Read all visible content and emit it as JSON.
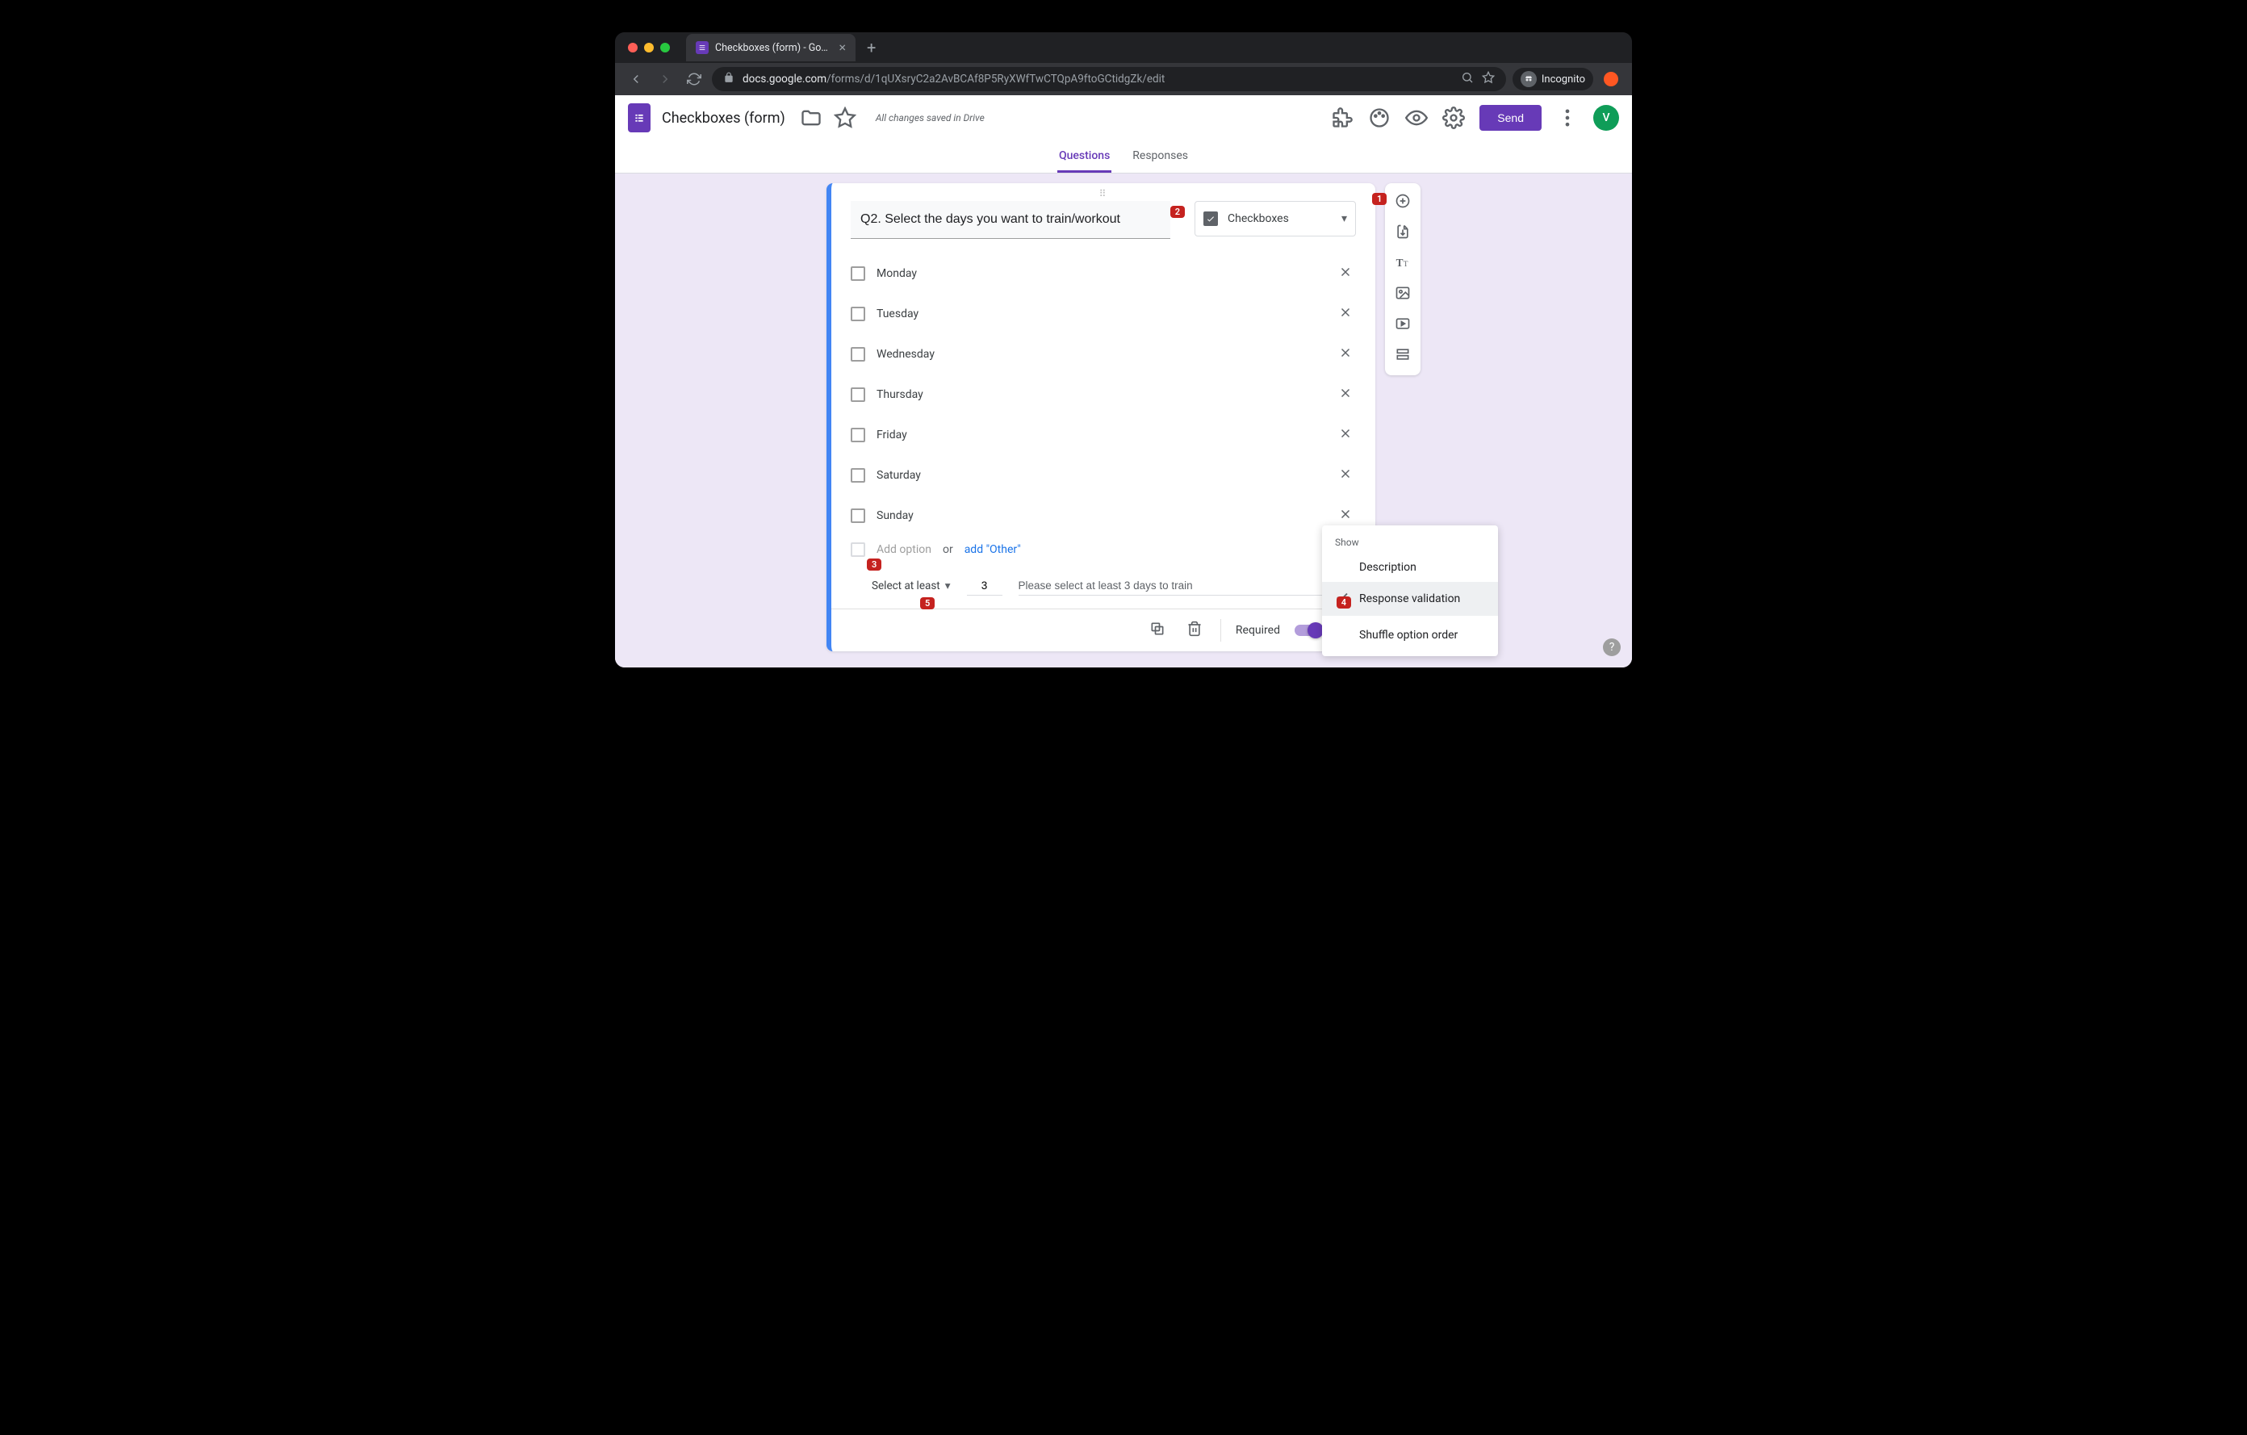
{
  "browser": {
    "tab_title": "Checkboxes (form) - Google Fo",
    "url_host": "docs.google.com",
    "url_path": "/forms/d/1qUXsryC2a2AvBCAf8P5RyXWfTwCTQpA9ftoGCtidgZk/edit",
    "incognito_label": "Incognito"
  },
  "header": {
    "doc_title": "Checkboxes (form)",
    "saved_status": "All changes saved in Drive",
    "send_label": "Send",
    "avatar_initial": "V"
  },
  "tabs": {
    "questions": "Questions",
    "responses": "Responses"
  },
  "question": {
    "title": "Q2. Select the days you want to train/workout",
    "type_label": "Checkboxes",
    "options": [
      "Monday",
      "Tuesday",
      "Wednesday",
      "Thursday",
      "Friday",
      "Saturday",
      "Sunday"
    ],
    "add_option_placeholder": "Add option",
    "or_text": "or",
    "add_other_label": "add \"Other\"",
    "validation": {
      "rule_label": "Select at least",
      "number": "3",
      "error_message": "Please select at least 3 days to train"
    },
    "required_label": "Required"
  },
  "context_menu": {
    "show_label": "Show",
    "items": {
      "description": "Description",
      "response_validation": "Response validation",
      "shuffle": "Shuffle option order"
    }
  },
  "badges": {
    "b1": "1",
    "b2": "2",
    "b3": "3",
    "b4": "4",
    "b5": "5"
  }
}
